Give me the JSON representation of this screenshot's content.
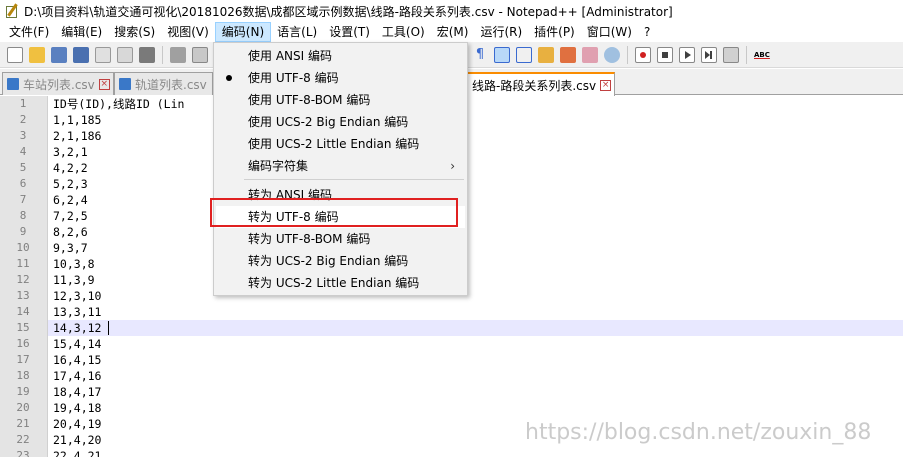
{
  "window": {
    "title": "D:\\项目资料\\轨道交通可视化\\20181026数据\\成都区域示例数据\\线路-路段关系列表.csv - Notepad++ [Administrator]"
  },
  "menubar": [
    {
      "label": "文件(F)"
    },
    {
      "label": "编辑(E)"
    },
    {
      "label": "搜索(S)"
    },
    {
      "label": "视图(V)"
    },
    {
      "label": "编码(N)",
      "active": true
    },
    {
      "label": "语言(L)"
    },
    {
      "label": "设置(T)"
    },
    {
      "label": "工具(O)"
    },
    {
      "label": "宏(M)"
    },
    {
      "label": "运行(R)"
    },
    {
      "label": "插件(P)"
    },
    {
      "label": "窗口(W)"
    },
    {
      "label": "?"
    }
  ],
  "tabs": [
    {
      "label": "车站列表.csv",
      "active": false
    },
    {
      "label": "轨道列表.csv",
      "active": false
    },
    {
      "label": "线路-路段关系列表.csv",
      "active": true
    }
  ],
  "encoding_menu": {
    "items": [
      {
        "label": "使用 ANSI 编码"
      },
      {
        "label": "使用 UTF-8 编码",
        "checked": true
      },
      {
        "label": "使用 UTF-8-BOM 编码"
      },
      {
        "label": "使用 UCS-2 Big Endian 编码"
      },
      {
        "label": "使用 UCS-2 Little Endian 编码"
      },
      {
        "label": "编码字符集",
        "submenu_arrow": "›"
      },
      {
        "label": "转为 ANSI 编码"
      },
      {
        "label": "转为 UTF-8 编码",
        "hover": true,
        "highlighted": true
      },
      {
        "label": "转为 UTF-8-BOM 编码"
      },
      {
        "label": "转为 UCS-2 Big Endian 编码"
      },
      {
        "label": "转为 UCS-2 Little Endian 编码"
      }
    ]
  },
  "editor": {
    "current_line": 15,
    "lines": [
      {
        "n": "1",
        "text": "ID号(ID),线路ID (Lin"
      },
      {
        "n": "2",
        "text": "1,1,185"
      },
      {
        "n": "3",
        "text": "2,1,186"
      },
      {
        "n": "4",
        "text": "3,2,1"
      },
      {
        "n": "5",
        "text": "4,2,2"
      },
      {
        "n": "6",
        "text": "5,2,3"
      },
      {
        "n": "7",
        "text": "6,2,4"
      },
      {
        "n": "8",
        "text": "7,2,5"
      },
      {
        "n": "9",
        "text": "8,2,6"
      },
      {
        "n": "10",
        "text": "9,3,7"
      },
      {
        "n": "11",
        "text": "10,3,8"
      },
      {
        "n": "12",
        "text": "11,3,9"
      },
      {
        "n": "13",
        "text": "12,3,10"
      },
      {
        "n": "14",
        "text": "13,3,11"
      },
      {
        "n": "15",
        "text": "14,3,12"
      },
      {
        "n": "16",
        "text": "15,4,14"
      },
      {
        "n": "17",
        "text": "16,4,15"
      },
      {
        "n": "18",
        "text": "17,4,16"
      },
      {
        "n": "19",
        "text": "18,4,17"
      },
      {
        "n": "20",
        "text": "19,4,18"
      },
      {
        "n": "21",
        "text": "20,4,19"
      },
      {
        "n": "22",
        "text": "21,4,20"
      },
      {
        "n": "23",
        "text": "22,4,21"
      }
    ]
  },
  "watermark": "https://blog.csdn.net/zouxin_88",
  "colors": {
    "highlight_box": "#e02020",
    "active_tab_accent": "#fa8c00",
    "current_line_bg": "#e8e8ff"
  }
}
